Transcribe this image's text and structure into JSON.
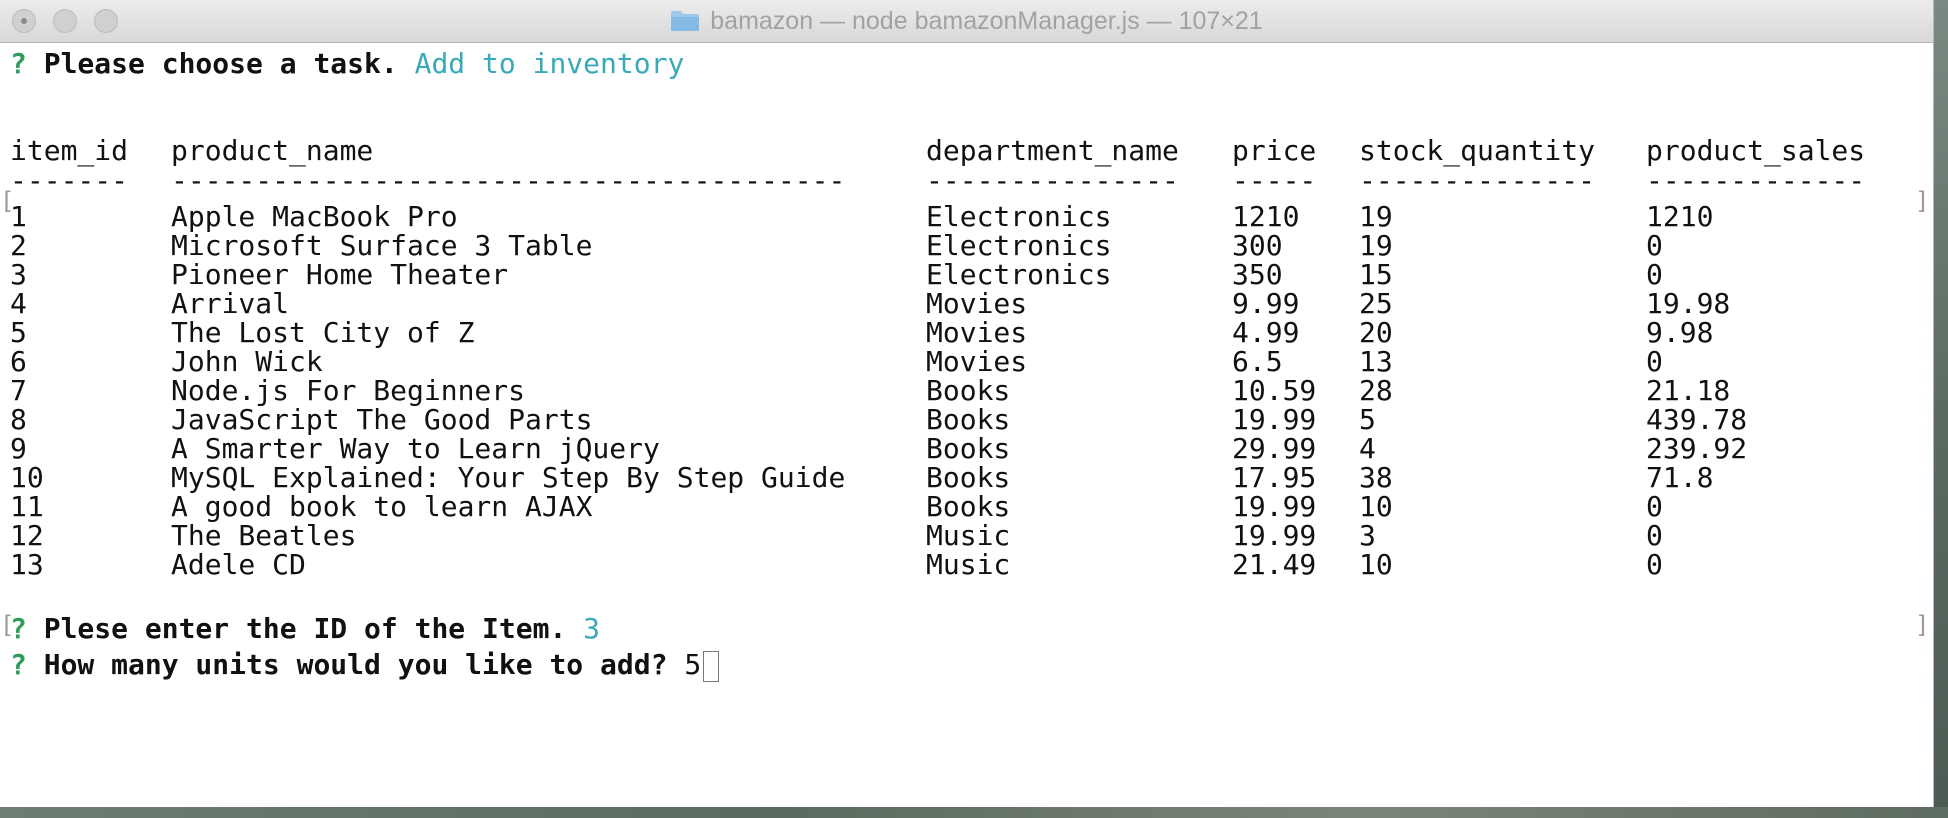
{
  "window": {
    "title": "bamazon — node bamazonManager.js — 107×21"
  },
  "prompt1": {
    "mark": "?",
    "question": "Please choose a task.",
    "answer": "Add to inventory"
  },
  "table": {
    "headers": [
      "item_id",
      "product_name",
      "department_name",
      "price",
      "stock_quantity",
      "product_sales"
    ],
    "dashes": [
      "-------",
      "----------------------------------------",
      "---------------",
      "-----",
      "--------------",
      "-------------"
    ],
    "rows": [
      [
        "1",
        "Apple MacBook Pro",
        "Electronics",
        "1210",
        "19",
        "1210"
      ],
      [
        "2",
        "Microsoft Surface 3 Table",
        "Electronics",
        "300",
        "19",
        "0"
      ],
      [
        "3",
        "Pioneer Home Theater",
        "Electronics",
        "350",
        "15",
        "0"
      ],
      [
        "4",
        "Arrival",
        "Movies",
        "9.99",
        "25",
        "19.98"
      ],
      [
        "5",
        "The Lost City of Z",
        "Movies",
        "4.99",
        "20",
        "9.98"
      ],
      [
        "6",
        "John Wick",
        "Movies",
        "6.5",
        "13",
        "0"
      ],
      [
        "7",
        "Node.js For Beginners",
        "Books",
        "10.59",
        "28",
        "21.18"
      ],
      [
        "8",
        "JavaScript The Good Parts",
        "Books",
        "19.99",
        "5",
        "439.78"
      ],
      [
        "9",
        "A Smarter Way to Learn jQuery",
        "Books",
        "29.99",
        "4",
        "239.92"
      ],
      [
        "10",
        "MySQL Explained: Your Step By Step Guide",
        "Books",
        "17.95",
        "38",
        "71.8"
      ],
      [
        "11",
        "A good book to learn AJAX",
        "Books",
        "19.99",
        "10",
        "0"
      ],
      [
        "12",
        "The Beatles",
        "Music",
        "19.99",
        "3",
        "0"
      ],
      [
        "13",
        "Adele CD",
        "Music",
        "21.49",
        "10",
        "0"
      ]
    ]
  },
  "prompt2": {
    "mark": "?",
    "question": "Plese enter the ID of the Item.",
    "answer": "3"
  },
  "prompt3": {
    "mark": "?",
    "question": "How many units would you like to add?",
    "value": "5"
  },
  "colors": {
    "prompt_mark": "#2e9d5a",
    "answer": "#3aa9b8"
  },
  "icons": {
    "title": "folder-icon"
  }
}
